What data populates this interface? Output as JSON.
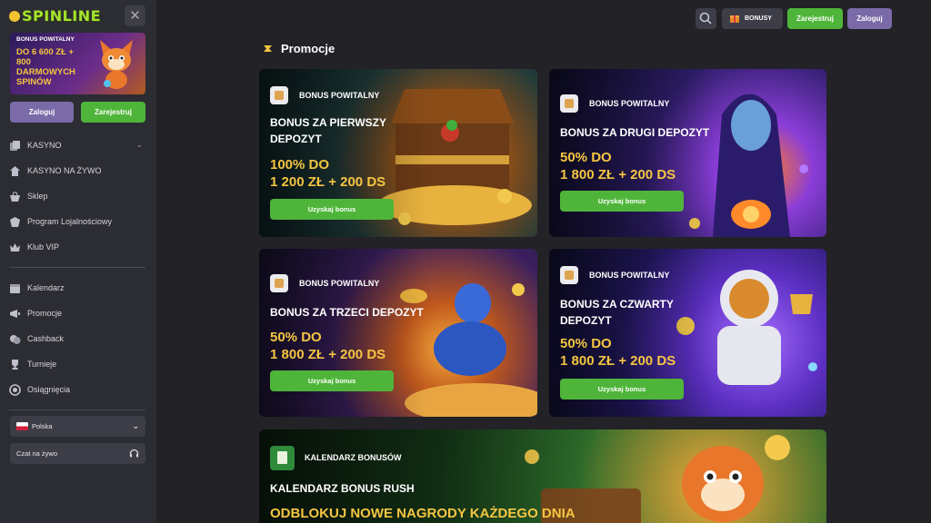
{
  "brand": {
    "logo_text": "SPINLINE"
  },
  "sidebar": {
    "banner": {
      "heading": "BONUS POWITALNY",
      "offer": "DO 6 600 ZŁ + 800 DARMOWYCH SPINÓW"
    },
    "login_label": "Zaloguj",
    "register_label": "Zarejestruj",
    "menu_group_1": [
      {
        "label": "KASYNO",
        "icon": "cards-icon",
        "has_chevron": true
      },
      {
        "label": "KASYNO NA ŻYWO",
        "icon": "live-casino-icon"
      },
      {
        "label": "Sklep",
        "icon": "shop-icon"
      },
      {
        "label": "Program Lojalnościowy",
        "icon": "loyalty-icon"
      },
      {
        "label": "Klub VIP",
        "icon": "crown-icon"
      }
    ],
    "menu_group_2": [
      {
        "label": "Kalendarz",
        "icon": "calendar-icon"
      },
      {
        "label": "Promocje",
        "icon": "promo-icon"
      },
      {
        "label": "Cashback",
        "icon": "cashback-icon"
      },
      {
        "label": "Turnieje",
        "icon": "trophy-icon"
      },
      {
        "label": "Osiągnięcia",
        "icon": "achievements-icon"
      }
    ],
    "language": "Polska",
    "chat_label": "Czat na żywo"
  },
  "header": {
    "bonus_label": "BONUSY",
    "register_label": "Zarejestruj",
    "login_label": "Zaloguj"
  },
  "main": {
    "section_title": "Promocje",
    "cards": [
      {
        "badge": "BONUS POWITALNY",
        "title": "BONUS ZA PIERWSZY DEPOZYT",
        "amount_line1": "100% DO",
        "amount_line2": "1 200 ZŁ + 200 DS",
        "cta": "Uzyskaj bonus"
      },
      {
        "badge": "BONUS POWITALNY",
        "title": "BONUS ZA DRUGI DEPOZYT",
        "amount_line1": "50% DO",
        "amount_line2": "1 800 ZŁ + 200 DS",
        "cta": "Uzyskaj bonus"
      },
      {
        "badge": "BONUS POWITALNY",
        "title": "BONUS ZA TRZECI DEPOZYT",
        "amount_line1": "50% DO",
        "amount_line2": "1 800 ZŁ + 200 DS",
        "cta": "Uzyskaj bonus"
      },
      {
        "badge": "BONUS POWITALNY",
        "title": "BONUS ZA CZWARTY DEPOZYT",
        "amount_line1": "50% DO",
        "amount_line2": "1 800 ZŁ + 200 DS",
        "cta": "Uzyskaj bonus"
      }
    ],
    "calendar_card": {
      "badge": "KALENDARZ BONUSÓW",
      "title": "KALENDARZ BONUS RUSH",
      "subtitle": "ODBLOKUJ NOWE NAGRODY KAŻDEGO DNIA"
    }
  },
  "colors": {
    "accent_green": "#4fb53a",
    "accent_purple": "#7a6aa8",
    "gold": "#f5c542",
    "sidebar_bg": "#2c2c33",
    "page_bg": "#222227"
  }
}
